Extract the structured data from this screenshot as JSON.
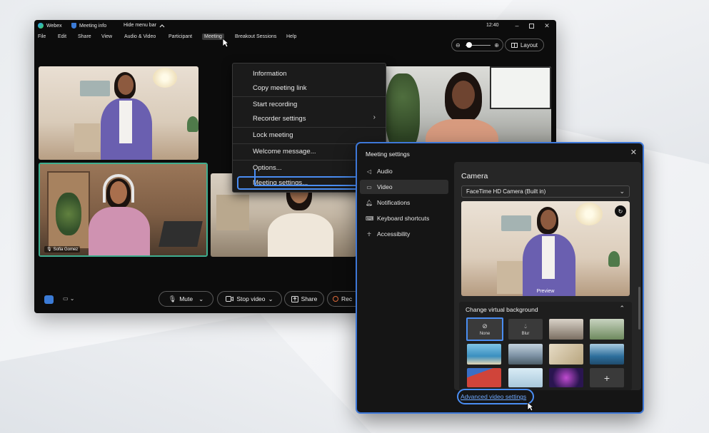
{
  "titlebar": {
    "app": "Webex",
    "meeting_info": "Meeting info",
    "hide_menu": "Hide menu bar",
    "time": "12:40"
  },
  "menubar": [
    "File",
    "Edit",
    "Share",
    "View",
    "Audio & Video",
    "Participant",
    "Meeting",
    "Breakout Sessions",
    "Help"
  ],
  "view_controls": {
    "layout": "Layout"
  },
  "meeting_menu": {
    "items": [
      "Information",
      "Copy meeting link",
      "Start recording",
      "Recorder settings",
      "Lock meeting",
      "Welcome message...",
      "Options...",
      "Meeting settings..."
    ],
    "highlighted": "Meeting settings..."
  },
  "participants": {
    "active_name": "Sofia Gomez"
  },
  "toolbar": {
    "mute": "Mute",
    "stop_video": "Stop video",
    "share": "Share",
    "record": "Rec"
  },
  "settings": {
    "title": "Meeting settings",
    "nav": [
      "Audio",
      "Video",
      "Notifications",
      "Keyboard shortcuts",
      "Accessibility"
    ],
    "selected": "Video",
    "camera_heading": "Camera",
    "camera_device": "FaceTime HD Camera (Built in)",
    "preview_label": "Preview",
    "virtual_bg_title": "Change virtual background",
    "bg_none": "None",
    "bg_blur": "Blur",
    "advanced_link": "Advanced video settings"
  },
  "colors": {
    "accent": "#4a8df2",
    "link": "#6fa9ff",
    "dialog_border": "#3e78d8"
  }
}
